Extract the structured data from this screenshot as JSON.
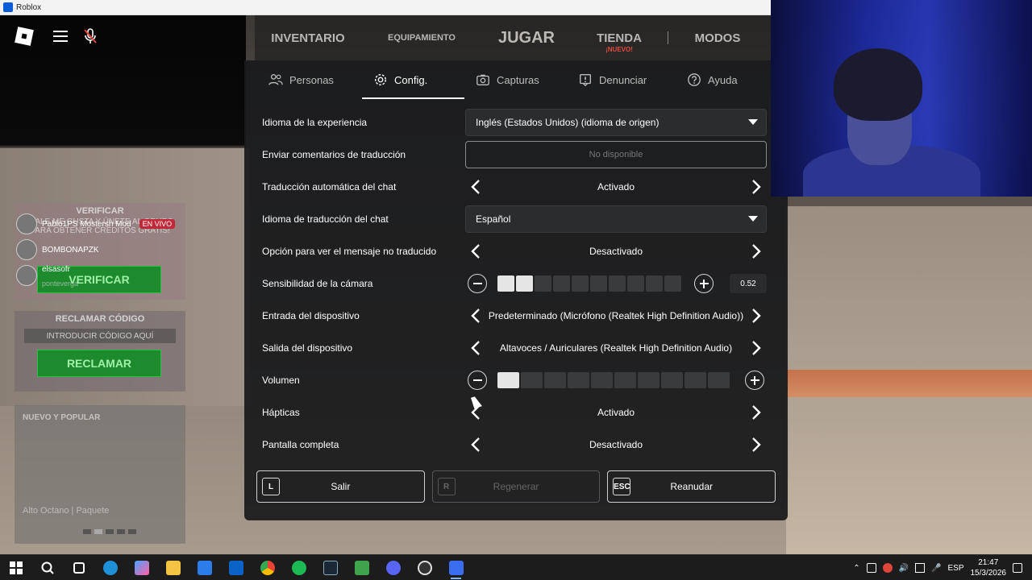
{
  "window": {
    "title": "Roblox"
  },
  "top_nav": {
    "items": [
      {
        "label": "INVENTARIO"
      },
      {
        "label": "EQUIPAMIENTO"
      },
      {
        "label": "JUGAR"
      },
      {
        "label": "TIENDA",
        "badge": "¡NUEVO!"
      },
      {
        "label": "MODOS"
      }
    ]
  },
  "tabs": [
    {
      "label": "Personas",
      "icon": "people-icon",
      "active": false
    },
    {
      "label": "Config.",
      "icon": "gear-icon",
      "active": true
    },
    {
      "label": "Capturas",
      "icon": "camera-icon",
      "active": false
    },
    {
      "label": "Denunciar",
      "icon": "flag-icon",
      "active": false
    },
    {
      "label": "Ayuda",
      "icon": "help-icon",
      "active": false
    }
  ],
  "settings": {
    "experience_language": {
      "label": "Idioma de la experiencia",
      "value": "Inglés (Estados Unidos) (idioma de origen)"
    },
    "send_translation_feedback": {
      "label": "Enviar comentarios de traducción",
      "value": "No disponible"
    },
    "auto_chat_translation": {
      "label": "Traducción automática del chat",
      "value": "Activado"
    },
    "chat_translation_language": {
      "label": "Idioma de traducción del chat",
      "value": "Español"
    },
    "show_untranslated": {
      "label": "Opción para ver el mensaje no traducido",
      "value": "Desactivado"
    },
    "camera_sensitivity": {
      "label": "Sensibilidad de la cámara",
      "value": "0.52",
      "level": 0.2,
      "segments": 10
    },
    "input_device": {
      "label": "Entrada del dispositivo",
      "value": "Predeterminado (Micrófono (Realtek High Definition Audio))"
    },
    "output_device": {
      "label": "Salida del dispositivo",
      "value": "Altavoces / Auriculares (Realtek High Definition Audio)"
    },
    "volume": {
      "label": "Volumen",
      "level": 0.1,
      "segments": 10
    },
    "haptics": {
      "label": "Hápticas",
      "value": "Activado"
    },
    "fullscreen": {
      "label": "Pantalla completa",
      "value": "Desactivado"
    }
  },
  "bottom_buttons": {
    "leave": {
      "key": "L",
      "label": "Salir"
    },
    "reset": {
      "key": "R",
      "label": "Regenerar"
    },
    "resume": {
      "key": "ESC",
      "label": "Reanudar"
    }
  },
  "side_panel": {
    "verify_title": "VERIFICAR",
    "verify_sub": "¡DALE ME GUSTA Y ÚNETE AL GRUPO PARA OBTENER CRÉDITOS GRATIS!",
    "verify_button": "VERIFICAR",
    "claim_title": "RECLAMAR CÓDIGO",
    "code_placeholder": "INTRODUCIR CÓDIGO AQUÍ",
    "claim_button": "RECLAMAR",
    "new_popular_title": "NUEVO Y POPULAR",
    "new_popular_item": "Alto Octano | Paquete"
  },
  "chat": [
    {
      "name": "Pablo1PS Mostersh Mod",
      "badge": "EN VIVO"
    },
    {
      "name": "BOMBONAPZK"
    },
    {
      "name": "elsasofr",
      "sub": "ponteverga"
    }
  ],
  "taskbar": {
    "language": "ESP",
    "time": "21:47",
    "date": "15/3/2026"
  }
}
